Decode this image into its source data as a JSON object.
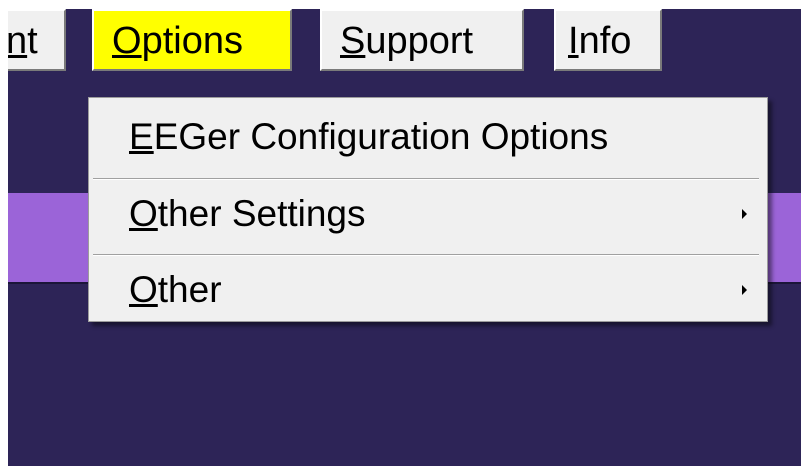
{
  "menubar": {
    "items": [
      {
        "label": "nt",
        "active": false
      },
      {
        "label": "Options",
        "active": true
      },
      {
        "label": "Support",
        "active": false
      },
      {
        "label": "Info",
        "active": false
      }
    ],
    "highlight_color": "#ffff00"
  },
  "options_menu": {
    "items": [
      {
        "label": "EEGer Configuration Options",
        "has_submenu": false
      },
      {
        "label": "Other Settings",
        "has_submenu": true
      },
      {
        "label": "Other",
        "has_submenu": true
      }
    ]
  },
  "colors": {
    "background": "#2d2457",
    "band": "#9b64d8",
    "menu_bg": "#f0f0f0"
  }
}
